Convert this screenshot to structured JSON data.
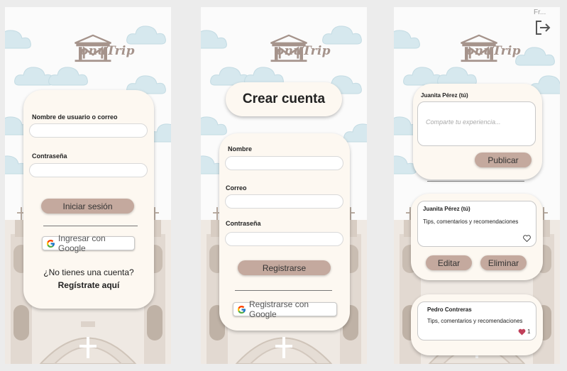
{
  "app": {
    "logo_text": "onuTrip"
  },
  "login": {
    "user_label": "Nombre de usuario o correo",
    "password_label": "Contraseña",
    "login_button": "Iniciar sesión",
    "google_button": "Ingresar con Google",
    "no_account": "¿No tienes una cuenta?",
    "register_link": "Regístrate aquí"
  },
  "signup": {
    "title": "Crear cuenta",
    "name_label": "Nombre",
    "email_label": "Correo",
    "password_label": "Contraseña",
    "register_button": "Registrarse",
    "google_button": "Registrarse con Google"
  },
  "feed": {
    "top_label": "Fr...",
    "composer": {
      "author": "Juanita Pérez (tú)",
      "placeholder": "Comparte tu experiencia...",
      "publish_button": "Publicar"
    },
    "posts": [
      {
        "author": "Juanita Pérez (tú)",
        "text": "Tips, comentarios y recomendaciones",
        "edit_button": "Editar",
        "delete_button": "Eliminar"
      },
      {
        "author": "Pedro Contreras",
        "text": "Tips, comentarios y recomendaciones",
        "likes": "1"
      }
    ]
  },
  "colors": {
    "accent": "#c4a99e",
    "card": "#fdf8f1",
    "cloud": "#d8e9ee",
    "church": "#e7e0da",
    "heart": "#c0405a"
  }
}
